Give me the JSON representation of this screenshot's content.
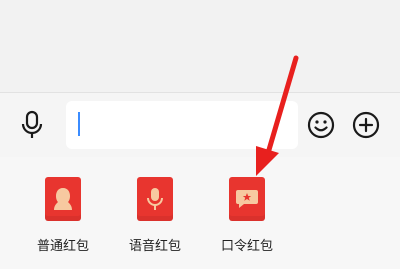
{
  "input": {
    "value": "",
    "placeholder": ""
  },
  "icons": {
    "voice": "microphone-icon",
    "emoji": "smiley-icon",
    "more": "plus-icon",
    "packet_normal": "person-silhouette-icon",
    "packet_voice": "microphone-icon",
    "packet_password": "speech-bubble-star-icon"
  },
  "panel": {
    "items": [
      {
        "label": "普通红包"
      },
      {
        "label": "语音红包"
      },
      {
        "label": "口令红包"
      }
    ]
  },
  "colors": {
    "packet_red": "#e8352f",
    "arrow_red": "#e8201e",
    "cursor_blue": "#3b8cff"
  }
}
